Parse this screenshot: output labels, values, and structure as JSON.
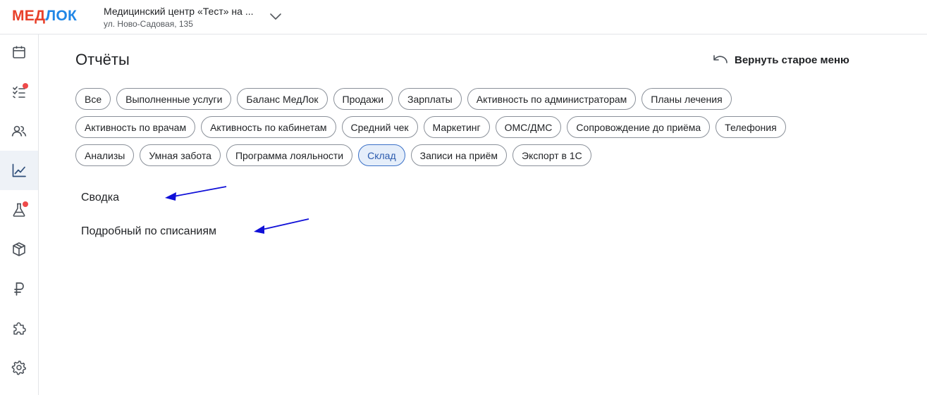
{
  "header": {
    "logo_part1": "МЕД",
    "logo_part2": "ЛОК",
    "clinic_name": "Медицинский центр «Тест» на ...",
    "clinic_address": "ул. Ново-Садовая, 135"
  },
  "sidebar": {
    "items": [
      {
        "icon": "calendar-icon",
        "active": false,
        "badge": false
      },
      {
        "icon": "checklist-icon",
        "active": false,
        "badge": true
      },
      {
        "icon": "users-icon",
        "active": false,
        "badge": false
      },
      {
        "icon": "chart-icon",
        "active": true,
        "badge": false
      },
      {
        "icon": "flask-icon",
        "active": false,
        "badge": true
      },
      {
        "icon": "box-icon",
        "active": false,
        "badge": false
      },
      {
        "icon": "ruble-icon",
        "active": false,
        "badge": false
      },
      {
        "icon": "puzzle-icon",
        "active": false,
        "badge": false
      },
      {
        "icon": "gear-icon",
        "active": false,
        "badge": false
      }
    ]
  },
  "main": {
    "title": "Отчёты",
    "restore_label": "Вернуть старое меню",
    "chips": [
      [
        "Все",
        "Выполненные услуги",
        "Баланс МедЛок",
        "Продажи",
        "Зарплаты",
        "Активность по администраторам",
        "Планы лечения"
      ],
      [
        "Активность по врачам",
        "Активность по кабинетам",
        "Средний чек",
        "Маркетинг",
        "ОМС/ДМС",
        "Сопровождение до приёма",
        "Телефония"
      ],
      [
        "Анализы",
        "Умная забота",
        "Программа лояльности",
        "Склад",
        "Записи на приём",
        "Экспорт в 1С"
      ]
    ],
    "selected_chip": "Склад",
    "reports": [
      "Сводка",
      "Подробный по списаниям"
    ]
  },
  "colors": {
    "logo_red": "#e8412b",
    "logo_blue": "#1f86e6",
    "chip_selected_bg": "#e5eefa",
    "chip_selected_border": "#3a70c7",
    "badge_red": "#ee4a4a",
    "annotation_arrow": "#1010d8"
  }
}
